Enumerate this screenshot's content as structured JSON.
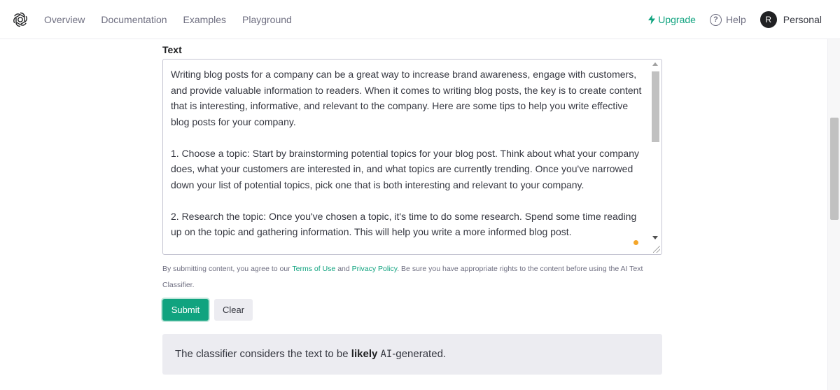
{
  "nav": {
    "items": [
      {
        "label": "Overview"
      },
      {
        "label": "Documentation"
      },
      {
        "label": "Examples"
      },
      {
        "label": "Playground"
      }
    ],
    "upgrade_label": "Upgrade",
    "help_label": "Help",
    "help_icon_glyph": "?",
    "avatar_initial": "R",
    "account_label": "Personal",
    "accent_color": "#10a37f"
  },
  "form": {
    "text_label": "Text",
    "text_value": [
      "Writing blog posts for a company can be a great way to increase brand awareness, engage with customers, and provide valuable information to readers. When it comes to writing blog posts, the key is to create content that is interesting, informative, and relevant to the company. Here are some tips to help you write effective blog posts for your company.",
      "1. Choose a topic: Start by brainstorming potential topics for your blog post. Think about what your company does, what your customers are interested in, and what topics are currently trending. Once you've narrowed down your list of potential topics, pick one that is both interesting and relevant to your company.",
      "2. Research the topic: Once you've chosen a topic, it's time to do some research. Spend some time reading up on the topic and gathering information. This will help you write a more informed blog post."
    ],
    "disclaimer_prefix": "By submitting content, you agree to our ",
    "terms_link": "Terms of Use",
    "disclaimer_and": " and ",
    "privacy_link": "Privacy Policy",
    "disclaimer_suffix": ". Be sure you have appropriate rights to the content before using the AI Text Classifier.",
    "submit_label": "Submit",
    "clear_label": "Clear"
  },
  "result": {
    "prefix": "The classifier considers the text to be ",
    "verdict": "likely",
    "space": " ",
    "ai_mono": "AI",
    "suffix": "-generated."
  },
  "icons": {
    "logo": "openai-logo-icon",
    "upgrade": "lightning-bolt-icon",
    "help": "question-circle-icon"
  }
}
